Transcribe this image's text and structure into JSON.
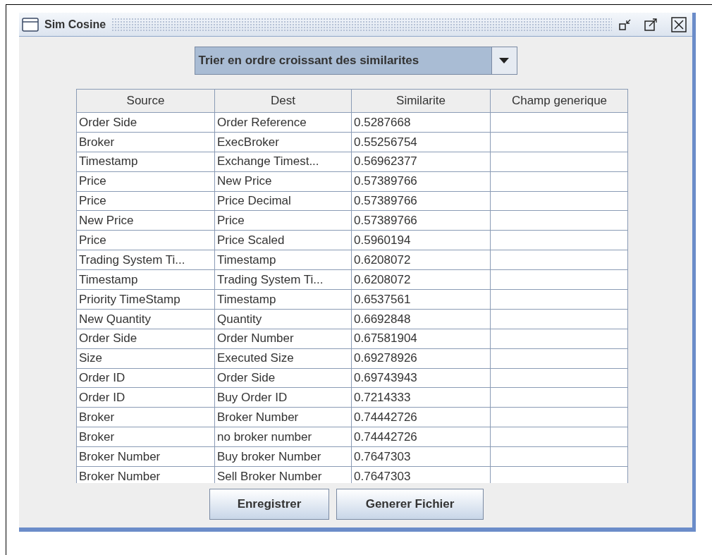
{
  "window": {
    "title": "Sim Cosine"
  },
  "sort_dropdown": {
    "value": "Trier en ordre croissant des similarites"
  },
  "table": {
    "columns": [
      "Source",
      "Dest",
      "Similarite",
      "Champ generique"
    ],
    "rows": [
      [
        "Order Side",
        "Order Reference",
        "0.5287668"
      ],
      [
        "Broker",
        "ExecBroker",
        "0.55256754"
      ],
      [
        "Timestamp",
        "Exchange Timest...",
        "0.56962377"
      ],
      [
        "Price",
        "New Price",
        "0.57389766"
      ],
      [
        "Price",
        "Price Decimal",
        "0.57389766"
      ],
      [
        "New Price",
        "Price",
        "0.57389766"
      ],
      [
        "Price",
        "Price Scaled",
        "0.5960194"
      ],
      [
        "Trading System Ti...",
        "Timestamp",
        "0.6208072"
      ],
      [
        "Timestamp",
        "Trading System Ti...",
        "0.6208072"
      ],
      [
        "Priority TimeStamp",
        "Timestamp",
        "0.6537561"
      ],
      [
        "New Quantity",
        "Quantity",
        "0.6692848"
      ],
      [
        "Order Side",
        "Order Number",
        "0.67581904"
      ],
      [
        "Size",
        "Executed Size",
        "0.69278926"
      ],
      [
        "Order ID",
        "Order Side",
        "0.69743943"
      ],
      [
        "Order ID",
        "Buy Order ID",
        "0.7214333"
      ],
      [
        "Broker",
        "Broker Number",
        "0.74442726"
      ],
      [
        "Broker",
        "no broker number",
        "0.74442726"
      ],
      [
        "Broker Number",
        "Buy broker Number",
        "0.7647303"
      ],
      [
        "Broker Number",
        "Sell Broker Number",
        "0.7647303"
      ]
    ]
  },
  "buttons": [
    "Enregistrer",
    "Generer Fichier"
  ]
}
